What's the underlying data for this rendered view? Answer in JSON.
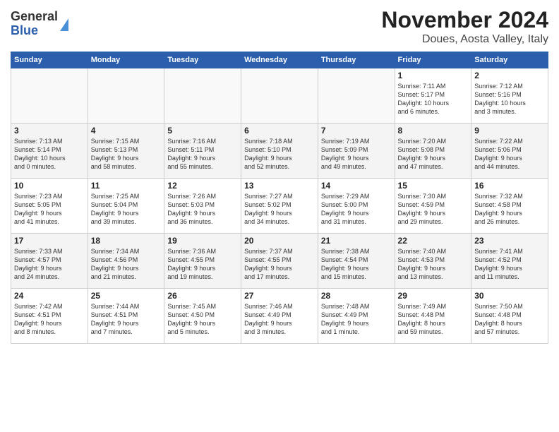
{
  "header": {
    "logo": {
      "line1": "General",
      "line2": "Blue"
    },
    "title": "November 2024",
    "subtitle": "Doues, Aosta Valley, Italy"
  },
  "days_of_week": [
    "Sunday",
    "Monday",
    "Tuesday",
    "Wednesday",
    "Thursday",
    "Friday",
    "Saturday"
  ],
  "weeks": [
    [
      {
        "day": "",
        "info": ""
      },
      {
        "day": "",
        "info": ""
      },
      {
        "day": "",
        "info": ""
      },
      {
        "day": "",
        "info": ""
      },
      {
        "day": "",
        "info": ""
      },
      {
        "day": "1",
        "info": "Sunrise: 7:11 AM\nSunset: 5:17 PM\nDaylight: 10 hours\nand 6 minutes."
      },
      {
        "day": "2",
        "info": "Sunrise: 7:12 AM\nSunset: 5:16 PM\nDaylight: 10 hours\nand 3 minutes."
      }
    ],
    [
      {
        "day": "3",
        "info": "Sunrise: 7:13 AM\nSunset: 5:14 PM\nDaylight: 10 hours\nand 0 minutes."
      },
      {
        "day": "4",
        "info": "Sunrise: 7:15 AM\nSunset: 5:13 PM\nDaylight: 9 hours\nand 58 minutes."
      },
      {
        "day": "5",
        "info": "Sunrise: 7:16 AM\nSunset: 5:11 PM\nDaylight: 9 hours\nand 55 minutes."
      },
      {
        "day": "6",
        "info": "Sunrise: 7:18 AM\nSunset: 5:10 PM\nDaylight: 9 hours\nand 52 minutes."
      },
      {
        "day": "7",
        "info": "Sunrise: 7:19 AM\nSunset: 5:09 PM\nDaylight: 9 hours\nand 49 minutes."
      },
      {
        "day": "8",
        "info": "Sunrise: 7:20 AM\nSunset: 5:08 PM\nDaylight: 9 hours\nand 47 minutes."
      },
      {
        "day": "9",
        "info": "Sunrise: 7:22 AM\nSunset: 5:06 PM\nDaylight: 9 hours\nand 44 minutes."
      }
    ],
    [
      {
        "day": "10",
        "info": "Sunrise: 7:23 AM\nSunset: 5:05 PM\nDaylight: 9 hours\nand 41 minutes."
      },
      {
        "day": "11",
        "info": "Sunrise: 7:25 AM\nSunset: 5:04 PM\nDaylight: 9 hours\nand 39 minutes."
      },
      {
        "day": "12",
        "info": "Sunrise: 7:26 AM\nSunset: 5:03 PM\nDaylight: 9 hours\nand 36 minutes."
      },
      {
        "day": "13",
        "info": "Sunrise: 7:27 AM\nSunset: 5:02 PM\nDaylight: 9 hours\nand 34 minutes."
      },
      {
        "day": "14",
        "info": "Sunrise: 7:29 AM\nSunset: 5:00 PM\nDaylight: 9 hours\nand 31 minutes."
      },
      {
        "day": "15",
        "info": "Sunrise: 7:30 AM\nSunset: 4:59 PM\nDaylight: 9 hours\nand 29 minutes."
      },
      {
        "day": "16",
        "info": "Sunrise: 7:32 AM\nSunset: 4:58 PM\nDaylight: 9 hours\nand 26 minutes."
      }
    ],
    [
      {
        "day": "17",
        "info": "Sunrise: 7:33 AM\nSunset: 4:57 PM\nDaylight: 9 hours\nand 24 minutes."
      },
      {
        "day": "18",
        "info": "Sunrise: 7:34 AM\nSunset: 4:56 PM\nDaylight: 9 hours\nand 21 minutes."
      },
      {
        "day": "19",
        "info": "Sunrise: 7:36 AM\nSunset: 4:55 PM\nDaylight: 9 hours\nand 19 minutes."
      },
      {
        "day": "20",
        "info": "Sunrise: 7:37 AM\nSunset: 4:55 PM\nDaylight: 9 hours\nand 17 minutes."
      },
      {
        "day": "21",
        "info": "Sunrise: 7:38 AM\nSunset: 4:54 PM\nDaylight: 9 hours\nand 15 minutes."
      },
      {
        "day": "22",
        "info": "Sunrise: 7:40 AM\nSunset: 4:53 PM\nDaylight: 9 hours\nand 13 minutes."
      },
      {
        "day": "23",
        "info": "Sunrise: 7:41 AM\nSunset: 4:52 PM\nDaylight: 9 hours\nand 11 minutes."
      }
    ],
    [
      {
        "day": "24",
        "info": "Sunrise: 7:42 AM\nSunset: 4:51 PM\nDaylight: 9 hours\nand 8 minutes."
      },
      {
        "day": "25",
        "info": "Sunrise: 7:44 AM\nSunset: 4:51 PM\nDaylight: 9 hours\nand 7 minutes."
      },
      {
        "day": "26",
        "info": "Sunrise: 7:45 AM\nSunset: 4:50 PM\nDaylight: 9 hours\nand 5 minutes."
      },
      {
        "day": "27",
        "info": "Sunrise: 7:46 AM\nSunset: 4:49 PM\nDaylight: 9 hours\nand 3 minutes."
      },
      {
        "day": "28",
        "info": "Sunrise: 7:48 AM\nSunset: 4:49 PM\nDaylight: 9 hours\nand 1 minute."
      },
      {
        "day": "29",
        "info": "Sunrise: 7:49 AM\nSunset: 4:48 PM\nDaylight: 8 hours\nand 59 minutes."
      },
      {
        "day": "30",
        "info": "Sunrise: 7:50 AM\nSunset: 4:48 PM\nDaylight: 8 hours\nand 57 minutes."
      }
    ]
  ]
}
